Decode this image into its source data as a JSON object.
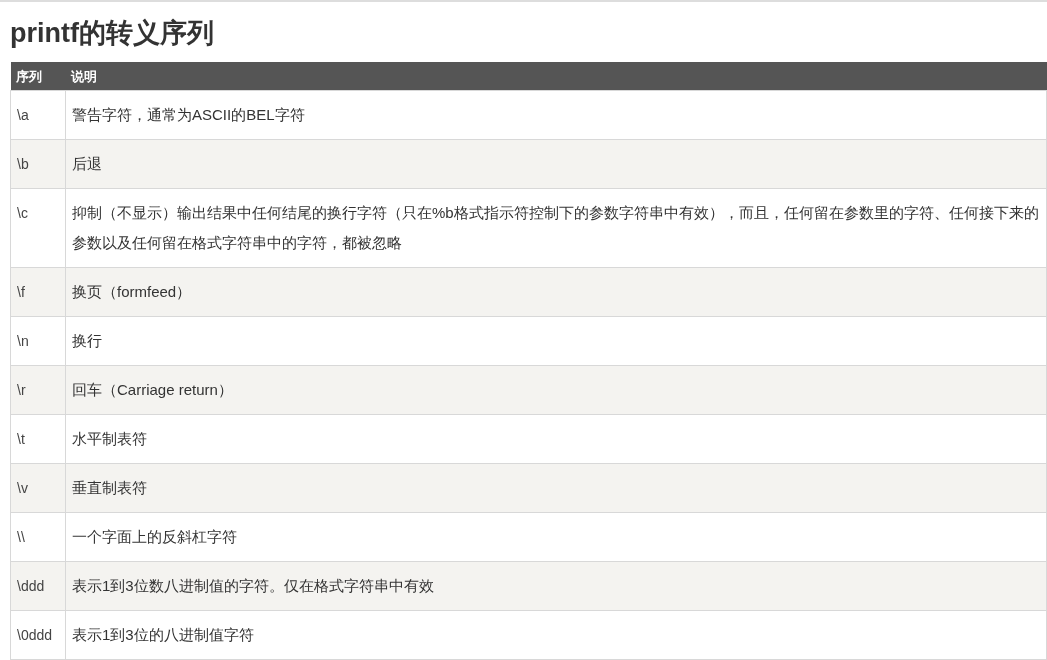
{
  "title": "printf的转义序列",
  "table": {
    "columns": [
      "序列",
      "说明"
    ],
    "rows": [
      {
        "sequence": "\\a",
        "description": "警告字符，通常为ASCII的BEL字符"
      },
      {
        "sequence": "\\b",
        "description": "后退"
      },
      {
        "sequence": "\\c",
        "description": "抑制（不显示）输出结果中任何结尾的换行字符（只在%b格式指示符控制下的参数字符串中有效），而且，任何留在参数里的字符、任何接下来的参数以及任何留在格式字符串中的字符，都被忽略"
      },
      {
        "sequence": "\\f",
        "description": "换页（formfeed）"
      },
      {
        "sequence": "\\n",
        "description": "换行"
      },
      {
        "sequence": "\\r",
        "description": "回车（Carriage return）"
      },
      {
        "sequence": "\\t",
        "description": "水平制表符"
      },
      {
        "sequence": "\\v",
        "description": "垂直制表符"
      },
      {
        "sequence": "\\\\",
        "description": "一个字面上的反斜杠字符"
      },
      {
        "sequence": "\\ddd",
        "description": "表示1到3位数八进制值的字符。仅在格式字符串中有效"
      },
      {
        "sequence": "\\0ddd",
        "description": "表示1到3位的八进制值字符"
      }
    ]
  }
}
